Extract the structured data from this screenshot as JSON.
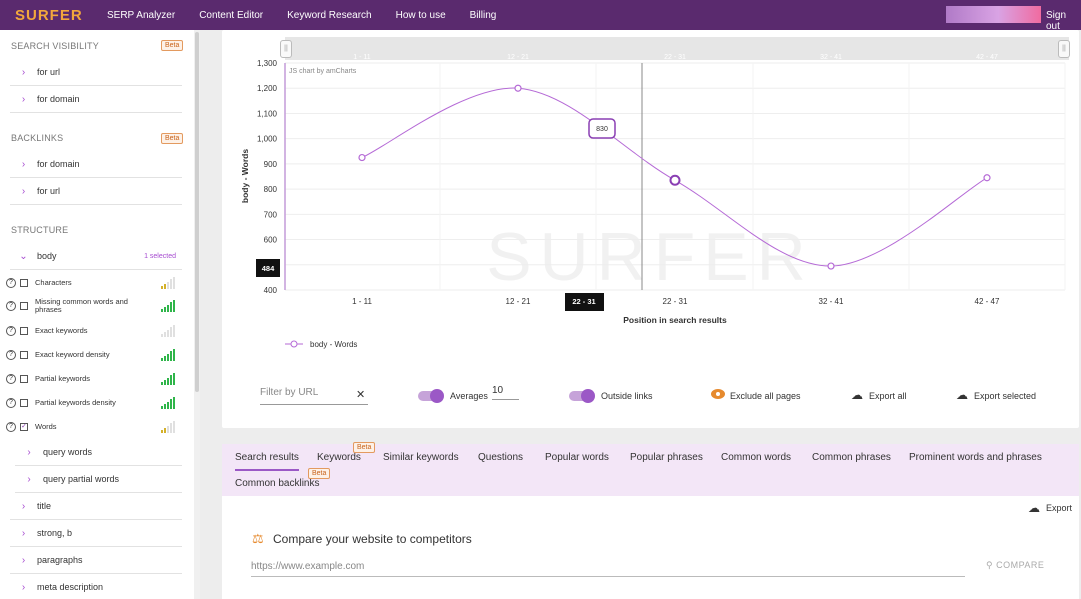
{
  "topbar": {
    "logo": "SURFER",
    "nav": [
      "SERP Analyzer",
      "Content Editor",
      "Keyword Research",
      "How to use",
      "Billing"
    ],
    "signout": "Sign out"
  },
  "sidebar": {
    "search_visibility": {
      "title": "SEARCH VISIBILITY",
      "badge": "Beta",
      "items": [
        "for url",
        "for domain"
      ]
    },
    "backlinks": {
      "title": "BACKLINKS",
      "badge": "Beta",
      "items": [
        "for domain",
        "for url"
      ]
    },
    "structure": {
      "title": "STRUCTURE",
      "body": {
        "label": "body",
        "selected": "1 selected"
      },
      "metrics": [
        {
          "label": "Characters",
          "checked": false,
          "bars": 2
        },
        {
          "label": "Missing common words and phrases",
          "checked": false,
          "bars": 5
        },
        {
          "label": "Exact keywords",
          "checked": false,
          "bars": 0
        },
        {
          "label": "Exact keyword density",
          "checked": false,
          "bars": 5
        },
        {
          "label": "Partial keywords",
          "checked": false,
          "bars": 5
        },
        {
          "label": "Partial keywords density",
          "checked": false,
          "bars": 5
        },
        {
          "label": "Words",
          "checked": true,
          "bars": 2
        }
      ],
      "sub_items": [
        "query words",
        "query partial words"
      ],
      "sections": [
        "title",
        "strong, b",
        "paragraphs",
        "meta description"
      ]
    }
  },
  "chart_data": {
    "type": "line",
    "credit": "JS chart by amCharts",
    "categories": [
      "1 - 11",
      "12 - 21",
      "22 - 31",
      "32 - 41",
      "42 - 47"
    ],
    "series": [
      {
        "name": "body - Words",
        "values": [
          925,
          1200,
          835,
          495,
          845
        ]
      }
    ],
    "ylabel": "body - Words",
    "xlabel": "Position in search results",
    "y_ticks": [
      "1,300",
      "1,200",
      "1,100",
      "1,000",
      "900",
      "800",
      "700",
      "600",
      "500",
      "400"
    ],
    "ylim": [
      400,
      1300
    ],
    "cursor_value": "830",
    "cursor_category": "22 - 31",
    "average_label": "484",
    "scrollbar_labels": [
      "1 - 11",
      "12 - 21",
      "22 - 31",
      "32 - 41",
      "42 - 47"
    ],
    "watermark": "SURFER",
    "line_color": "#b56ad6"
  },
  "controls": {
    "filter_placeholder": "Filter by URL",
    "averages_label": "Averages",
    "averages_value": "10",
    "outside_links_label": "Outside links",
    "exclude_label": "Exclude all pages",
    "export_all": "Export all",
    "export_selected": "Export selected"
  },
  "tabs": {
    "items": [
      "Search results",
      "Keywords",
      "Similar keywords",
      "Questions",
      "Popular words",
      "Popular phrases",
      "Common words",
      "Common phrases",
      "Prominent words and phrases",
      "Common backlinks"
    ],
    "badges": [
      "Beta",
      "Beta"
    ],
    "export": "Export",
    "compare_title": "Compare your website to competitors",
    "url_placeholder": "https://www.example.com",
    "compare_button": "COMPARE"
  }
}
